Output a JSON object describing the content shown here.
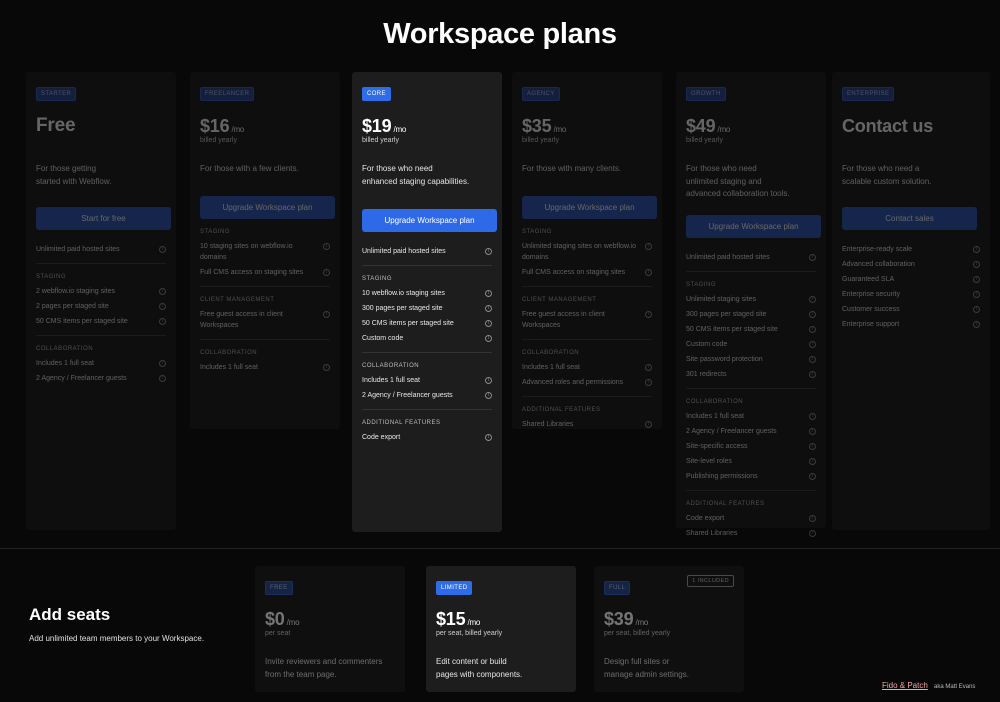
{
  "page": {
    "title": "Workspace plans"
  },
  "plans": [
    {
      "badge": "Starter",
      "price": "Free",
      "per": "",
      "billed": "",
      "desc": [
        "For those getting",
        "started with Webflow."
      ],
      "button": "Start for free",
      "sections": [
        {
          "label": "",
          "items": [
            "Unlimited paid hosted sites"
          ]
        },
        {
          "label": "Staging",
          "items": [
            "2 webflow.io staging sites",
            "2 pages per staged site",
            "50 CMS items per staged site"
          ]
        },
        {
          "label": "Collaboration",
          "items": [
            "Includes 1 full seat",
            "2 Agency / Freelancer guests"
          ]
        }
      ]
    },
    {
      "badge": "Freelancer",
      "price": "$16",
      "per": "/mo",
      "billed": "billed yearly",
      "desc": [
        "For those with a few clients."
      ],
      "button": "Upgrade Workspace plan",
      "sections": [
        {
          "label": "Staging",
          "items": [
            "10 staging sites on webflow.io domains",
            "Full CMS access on staging sites"
          ]
        },
        {
          "label": "Client management",
          "items": [
            "Free guest access in client Workspaces"
          ]
        },
        {
          "label": "Collaboration",
          "items": [
            "Includes 1 full seat"
          ]
        }
      ]
    },
    {
      "badge": "Core",
      "price": "$19",
      "per": "/mo",
      "billed": "billed yearly",
      "desc": [
        "For those who need",
        "enhanced staging capabilities."
      ],
      "button": "Upgrade Workspace plan",
      "sections": [
        {
          "label": "",
          "items": [
            "Unlimited paid hosted sites"
          ]
        },
        {
          "label": "Staging",
          "items": [
            "10 webflow.io staging sites",
            "300 pages per staged site",
            "50 CMS items per staged site",
            "Custom code"
          ]
        },
        {
          "label": "Collaboration",
          "items": [
            "Includes 1 full seat",
            "2 Agency / Freelancer guests"
          ]
        },
        {
          "label": "Additional features",
          "items": [
            "Code export"
          ]
        }
      ]
    },
    {
      "badge": "Agency",
      "price": "$35",
      "per": "/mo",
      "billed": "billed yearly",
      "desc": [
        "For those with many clients."
      ],
      "button": "Upgrade Workspace plan",
      "sections": [
        {
          "label": "Staging",
          "items": [
            "Unlimited staging sites on webflow.io domains",
            "Full CMS access on staging sites"
          ]
        },
        {
          "label": "Client management",
          "items": [
            "Free guest access in client Workspaces"
          ]
        },
        {
          "label": "Collaboration",
          "items": [
            "Includes 1 full seat",
            "Advanced roles and permissions"
          ]
        },
        {
          "label": "Additional features",
          "items": [
            "Shared Libraries"
          ]
        }
      ]
    },
    {
      "badge": "Growth",
      "price": "$49",
      "per": "/mo",
      "billed": "billed yearly",
      "desc": [
        "For those who need",
        "unlimited staging and",
        "advanced collaboration tools."
      ],
      "button": "Upgrade Workspace plan",
      "sections": [
        {
          "label": "",
          "items": [
            "Unlimited paid hosted sites"
          ]
        },
        {
          "label": "Staging",
          "items": [
            "Unlimited staging sites",
            "300 pages per staged site",
            "50 CMS items per staged site",
            "Custom code",
            "Site password protection",
            "301 redirects"
          ]
        },
        {
          "label": "Collaboration",
          "items": [
            "Includes 1 full seat",
            "2 Agency / Freelancer guests",
            "Site-specific access",
            "Site-level roles",
            "Publishing permissions"
          ]
        },
        {
          "label": "Additional features",
          "items": [
            "Code export",
            "Shared Libraries"
          ]
        }
      ]
    },
    {
      "badge": "Enterprise",
      "price": "Contact us",
      "per": "",
      "billed": "",
      "desc": [
        "For those who need a",
        "scalable custom solution."
      ],
      "button": "Contact sales",
      "sections": [
        {
          "label": "",
          "items": [
            "Enterprise-ready scale",
            "Advanced collaboration",
            "Guaranteed SLA",
            "Enterprise security",
            "Customer success",
            "Enterprise support"
          ]
        }
      ]
    }
  ],
  "seats": {
    "title": "Add seats",
    "subtitle": "Add unlimited team members to your Workspace.",
    "cards": [
      {
        "badge": "Free",
        "price": "$0",
        "per": "/mo",
        "billed": "per seat",
        "desc": [
          "Invite reviewers and commenters",
          "from the team page."
        ],
        "included": ""
      },
      {
        "badge": "Limited",
        "price": "$15",
        "per": "/mo",
        "billed": "per seat, billed yearly",
        "desc": [
          "Edit content or build",
          "pages with components."
        ],
        "included": ""
      },
      {
        "badge": "Full",
        "price": "$39",
        "per": "/mo",
        "billed": "per seat, billed yearly",
        "desc": [
          "Design full sites or",
          "manage admin settings."
        ],
        "included": "1 included"
      }
    ]
  },
  "credit": {
    "brand": "Fido & Patch",
    "aka": "aka Matt Evans"
  },
  "colors": {
    "accent": "#2e6ae8",
    "background": "#080808",
    "card": "#1d1d1d"
  }
}
